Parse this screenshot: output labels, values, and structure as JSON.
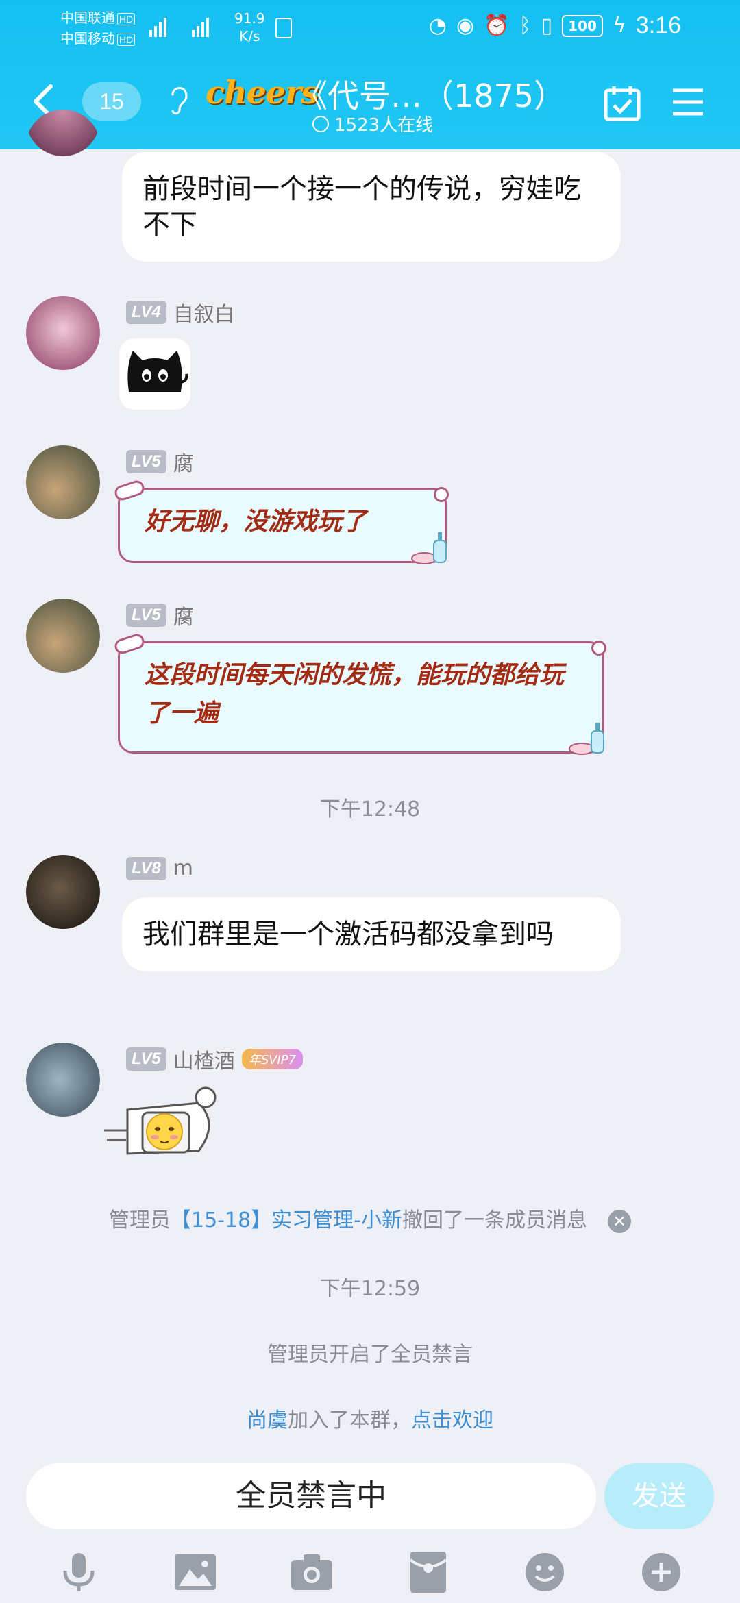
{
  "status_bar": {
    "carrier1": "中国联通",
    "carrier2": "中国移动",
    "hd": "HD",
    "net_speed": "91.9",
    "net_unit": "K/s",
    "battery": "100",
    "time": "3:16"
  },
  "header": {
    "unread_count": "15",
    "logo_text": "cheers",
    "title": "《代号…（1875）",
    "online": "1523人在线"
  },
  "messages": [
    {
      "text": "前段时间一个接一个的传说，穷娃吃不下"
    },
    {
      "level": "LV4",
      "name": "自叙白",
      "sticker": "black-cat-sticker"
    },
    {
      "level": "LV5",
      "name": "腐",
      "text": "好无聊，没游戏玩了"
    },
    {
      "level": "LV5",
      "name": "腐",
      "text": "这段时间每天闲的发慌，能玩的都给玩了一遍"
    },
    {
      "level": "LV8",
      "name": "m",
      "text": "我们群里是一个激活码都没拿到吗"
    },
    {
      "level": "LV5",
      "name": "山楂酒",
      "vip": "年SVIP7",
      "sticker": "rocket-face-sticker"
    }
  ],
  "time_1248": "下午12:48",
  "time_1259": "下午12:59",
  "recall": {
    "prefix": "管理员",
    "admin": "【15-18】实习管理-小新",
    "suffix": "撤回了一条成员消息"
  },
  "mute_notice": "管理员开启了全员禁言",
  "join": {
    "name": "尚虞",
    "text": "加入了本群，",
    "welcome": "点击欢迎"
  },
  "input": {
    "placeholder": "全员禁言中",
    "send": "发送"
  },
  "colors": {
    "header": "#14bff0",
    "link": "#3d8fd6",
    "background": "#eef0f5"
  }
}
